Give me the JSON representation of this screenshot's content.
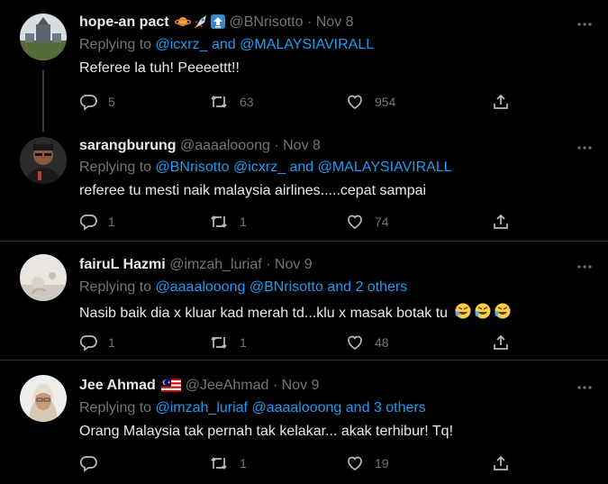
{
  "tweets": [
    {
      "name": "hope-an pact",
      "handle": "@BNrisotto",
      "date": "Nov 8",
      "replying_prefix": "Replying to ",
      "replying_targets": "@icxrz_ and @MALAYSIAVIRALL",
      "text": "Referee la tuh! Peeeettt!!",
      "replies": "5",
      "retweets": "63",
      "likes": "954"
    },
    {
      "name": "sarangburung",
      "handle": "@aaaalooong",
      "date": "Nov 8",
      "replying_prefix": "Replying to ",
      "replying_targets": "@BNrisotto @icxrz_ and @MALAYSIAVIRALL",
      "text": "referee tu mesti naik malaysia airlines.....cepat sampai",
      "replies": "1",
      "retweets": "1",
      "likes": "74"
    },
    {
      "name": "fairuL Hazmi",
      "handle": "@imzah_luriaf",
      "date": "Nov 9",
      "replying_prefix": "Replying to ",
      "replying_targets": "@aaaalooong @BNrisotto and 2 others",
      "text": "Nasib baik dia x kluar kad merah td...klu x masak botak tu",
      "replies": "1",
      "retweets": "1",
      "likes": "48"
    },
    {
      "name": "Jee Ahmad",
      "handle": "@JeeAhmad",
      "date": "Nov 9",
      "replying_prefix": "Replying to ",
      "replying_targets": "@imzah_luriaf @aaaalooong and 3 others",
      "text": "Orang Malaysia tak pernah tak kelakar... akak terhibur! Tq!",
      "replies": "",
      "retweets": "1",
      "likes": "19"
    }
  ],
  "separator": " · ",
  "colors": {
    "link": "#1d9bf0",
    "muted": "#71767b",
    "text": "#e7e9ea",
    "background": "#000000"
  }
}
